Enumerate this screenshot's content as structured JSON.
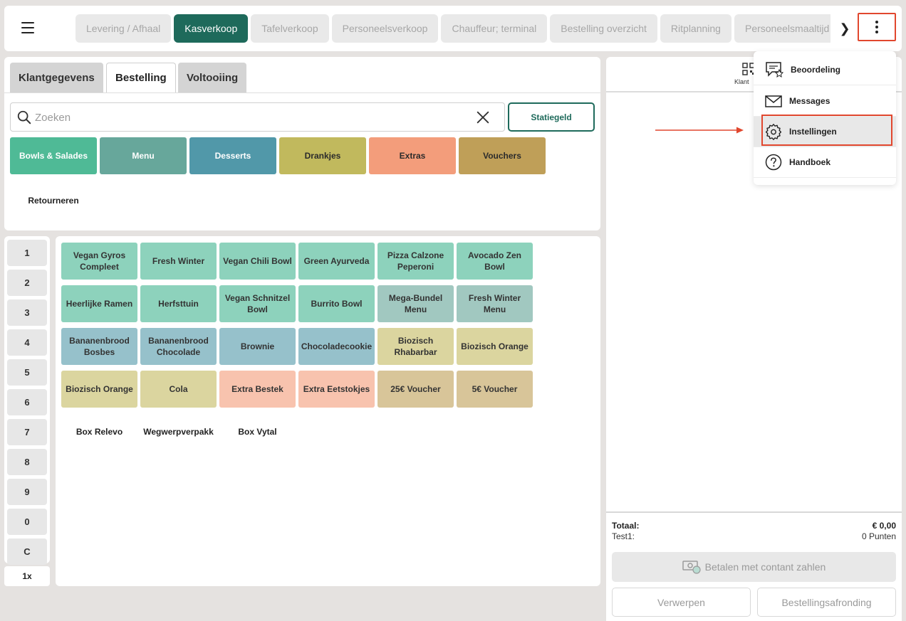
{
  "topbar": {
    "tabs": [
      "Levering / Afhaal",
      "Kasverkoop",
      "Tafelverkoop",
      "Personeelsverkoop",
      "Chauffeur; terminal",
      "Bestelling overzicht",
      "Ritplanning",
      "Personeelsmaaltijd"
    ],
    "active_tab": "Kasverkoop",
    "scroll_right": "❯"
  },
  "order_tabs": {
    "klantgegevens": "Klantgegevens",
    "bestelling": "Bestelling",
    "voltooiing": "Voltooiing"
  },
  "search": {
    "placeholder": "Zoeken",
    "value": "",
    "statiegeld": "Statiegeld"
  },
  "categories": [
    {
      "label": "Bowls & Salades",
      "color": "#4fba96",
      "text": "#ffffff"
    },
    {
      "label": "Menu",
      "color": "#67a79b",
      "text": "#ffffff"
    },
    {
      "label": "Desserts",
      "color": "#5198a9",
      "text": "#ffffff"
    },
    {
      "label": "Drankjes",
      "color": "#c1b95d",
      "text": "#2b2b2b"
    },
    {
      "label": "Extras",
      "color": "#f39d7b",
      "text": "#2b2b2b"
    },
    {
      "label": "Vouchers",
      "color": "#bf9f58",
      "text": "#2b2b2b"
    }
  ],
  "retourneren": "Retourneren",
  "numpad": [
    "1",
    "2",
    "3",
    "4",
    "5",
    "6",
    "7",
    "8",
    "9",
    "0",
    "C"
  ],
  "multiplier": "1x",
  "products": [
    {
      "label": "Vegan Gyros Compleet",
      "color": "#8dd2bc"
    },
    {
      "label": "Fresh Winter",
      "color": "#8dd2bc"
    },
    {
      "label": "Vegan Chili Bowl",
      "color": "#8dd2bc"
    },
    {
      "label": "Green Ayurveda",
      "color": "#8dd2bc"
    },
    {
      "label": "Pizza Calzone Peperoni",
      "color": "#8dd2bc"
    },
    {
      "label": "Avocado Zen Bowl",
      "color": "#8dd2bc"
    },
    {
      "label": "Heerlijke Ramen",
      "color": "#8dd2bc"
    },
    {
      "label": "Herfsttuin",
      "color": "#8dd2bc"
    },
    {
      "label": "Vegan Schnitzel Bowl",
      "color": "#8dd2bc"
    },
    {
      "label": "Burrito Bowl",
      "color": "#8dd2bc"
    },
    {
      "label": "Mega-Bundel Menu",
      "color": "#a1c8c0"
    },
    {
      "label": "Fresh Winter Menu",
      "color": "#a1c8c0"
    },
    {
      "label": "Bananenbrood Bosbes",
      "color": "#96c1cb"
    },
    {
      "label": "Bananenbrood Chocolade",
      "color": "#96c1cb"
    },
    {
      "label": "Brownie",
      "color": "#96c1cb"
    },
    {
      "label": "Chocoladecookie",
      "color": "#96c1cb"
    },
    {
      "label": "Biozisch Rhabarbar",
      "color": "#dbd59f"
    },
    {
      "label": "Biozisch Orange",
      "color": "#dbd59f"
    },
    {
      "label": "Biozisch Orange",
      "color": "#dbd59f"
    },
    {
      "label": "Cola",
      "color": "#dbd59f"
    },
    {
      "label": "Extra Bestek",
      "color": "#f8c3ae"
    },
    {
      "label": "Extra Eetstokjes",
      "color": "#f8c3ae"
    },
    {
      "label": "25€ Voucher",
      "color": "#d8c599"
    },
    {
      "label": "5€ Voucher",
      "color": "#d8c599"
    }
  ],
  "packaging": [
    "Box Relevo",
    "Wegwerpverpakk",
    "Box Vytal"
  ],
  "order": {
    "klant_label": "Klant",
    "totaal_label": "Totaal:",
    "totaal_value": "€ 0,00",
    "test_label": "Test1:",
    "test_value": "0 Punten",
    "pay_label": "Betalen met contant zahlen",
    "discard_label": "Verwerpen",
    "finish_label": "Bestellingsafronding"
  },
  "menu": {
    "items": [
      {
        "label": "Beoordeling",
        "icon": "review-icon"
      },
      {
        "label": "Messages",
        "icon": "mail-icon"
      },
      {
        "label": "Instellingen",
        "icon": "gear-icon"
      },
      {
        "label": "Handboek",
        "icon": "help-icon"
      }
    ],
    "highlighted": "Instellingen"
  },
  "colors": {
    "accent": "#1e6a5b",
    "annotation": "#e1472e"
  }
}
